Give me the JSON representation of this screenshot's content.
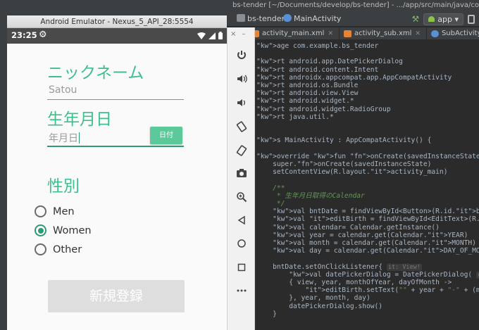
{
  "ide": {
    "window_title": "bs-tender [~/Documents/develop/bs-tender] - .../app/src/main/java/com/example/bs_tender",
    "breadcrumb_project": "bs-tender",
    "breadcrumb_class": "MainActivity",
    "run_config": "app",
    "tabs": [
      {
        "label": "activity_main.xml"
      },
      {
        "label": "activity_sub.xml"
      },
      {
        "label": "SubActivity.kt"
      }
    ],
    "code_lines": [
      "age com.example.bs_tender",
      "",
      "rt android.app.DatePickerDialog",
      "rt android.content.Intent",
      "rt androidx.appcompat.app.AppCompatActivity",
      "rt android.os.Bundle",
      "rt android.view.View",
      "rt android.widget.*",
      "rt android.widget.RadioGroup",
      "rt java.util.*",
      "",
      "",
      "s MainActivity : AppCompatActivity() {",
      "",
      "override fun onCreate(savedInstanceState: Bundle?) {",
      "    super.onCreate(savedInstanceState)",
      "    setContentView(R.layout.activity_main)",
      "",
      "    /**",
      "     * 生年月日取得のCalendar",
      "     */",
      "    val bntDate = findViewById<Button>(R.id.btnDate)",
      "    val editBirth = findViewById<EditText>(R.id.editBirth)",
      "    val calendar= Calendar.getInstance()",
      "    val year = calendar.get(Calendar.YEAR)",
      "    val month = calendar.get(Calendar.MONTH)",
      "    val day = calendar.get(Calendar.DAY_OF_MONTH)",
      "",
      "    bntDate.setOnClickListener{",
      "        val datePickerDialog = DatePickerDialog(",
      "        { view, year, monthOfYear, dayOfMonth ->",
      "            editBirth.setText(\"\" + year + \"-\" + (monthOfYear",
      "        }, year, month, day)",
      "        datePickerDialog.show()",
      "    }"
    ],
    "hint_view": "it: View!",
    "hint_context": "context:",
    "hint_this": "thi"
  },
  "emulator": {
    "window_title": "Android Emulator - Nexus_5_API_28:5554",
    "status_time": "23:25"
  },
  "app": {
    "nickname_label": "ニックネーム",
    "nickname_value": "Satou",
    "birth_label": "生年月日",
    "birth_placeholder": "年月日",
    "date_button": "日付",
    "gender_label": "性別",
    "gender_options": [
      {
        "label": "Men",
        "checked": false
      },
      {
        "label": "Women",
        "checked": true
      },
      {
        "label": "Other",
        "checked": false
      }
    ],
    "register_button": "新規登録"
  },
  "colors": {
    "accent": "#3dbf8e",
    "radio_checked": "#2e9a78",
    "date_button_bg": "#5cc99a",
    "ide_bg": "#2b2b2b"
  }
}
